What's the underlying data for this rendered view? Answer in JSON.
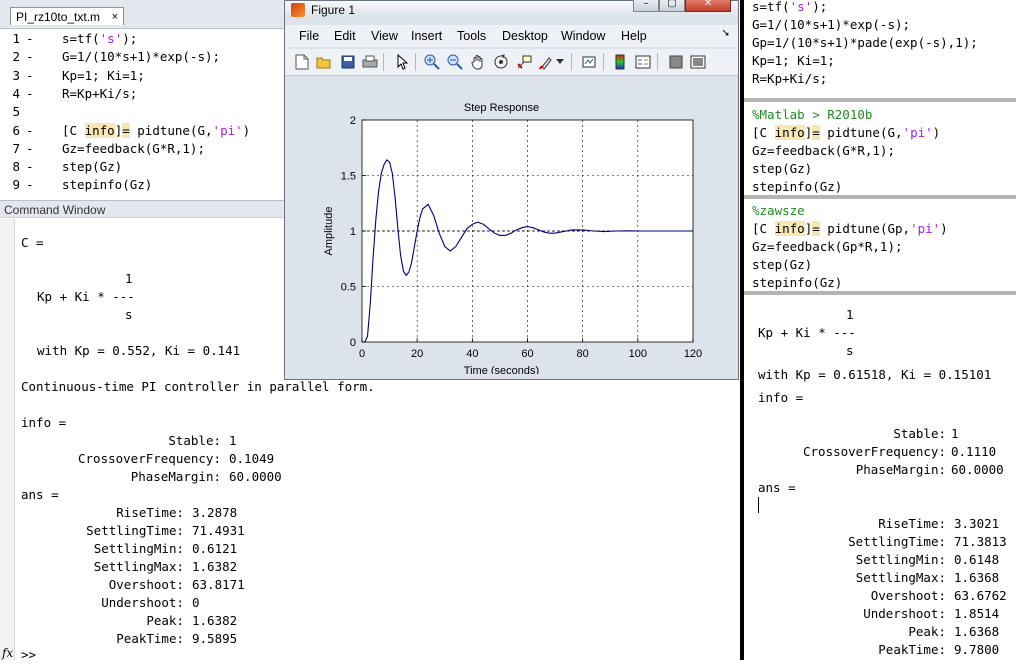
{
  "editor": {
    "tab_label": "PI_rz10to_txt.m",
    "close_label": "×",
    "lines": [
      {
        "num": "1",
        "dash": "-",
        "code": "s=tf('s');"
      },
      {
        "num": "2",
        "dash": "-",
        "code": "G=1/(10*s+1)*exp(-s);"
      },
      {
        "num": "3",
        "dash": "-",
        "code": "Kp=1; Ki=1;"
      },
      {
        "num": "4",
        "dash": "-",
        "code": "R=Kp+Ki/s;"
      },
      {
        "num": "5",
        "dash": "",
        "code": ""
      },
      {
        "num": "6",
        "dash": "-",
        "code": "[C info]= pidtune(G,'pi')"
      },
      {
        "num": "7",
        "dash": "-",
        "code": "Gz=feedback(G*R,1);"
      },
      {
        "num": "8",
        "dash": "-",
        "code": "step(Gz)"
      },
      {
        "num": "9",
        "dash": "-",
        "code": "stepinfo(Gz)"
      }
    ]
  },
  "command_window": {
    "title": "Command Window",
    "fx_label": "fx",
    "prompt": ">>",
    "c_label": "C =",
    "tf_numerator": "1",
    "tf_line": "Kp + Ki * ---",
    "tf_denominator": "s",
    "gains_line": "with Kp = 0.552, Ki = 0.141",
    "controller_desc": "Continuous-time PI controller in parallel form.",
    "info_label": "info =",
    "info": [
      {
        "key": "Stable:",
        "value": "1"
      },
      {
        "key": "CrossoverFrequency:",
        "value": "0.1049"
      },
      {
        "key": "PhaseMargin:",
        "value": "60.0000"
      }
    ],
    "ans_label": "ans =",
    "ans": [
      {
        "key": "RiseTime:",
        "value": "3.2878"
      },
      {
        "key": "SettlingTime:",
        "value": "71.4931"
      },
      {
        "key": "SettlingMin:",
        "value": "0.6121"
      },
      {
        "key": "SettlingMax:",
        "value": "1.6382"
      },
      {
        "key": "Overshoot:",
        "value": "63.8171"
      },
      {
        "key": "Undershoot:",
        "value": "0"
      },
      {
        "key": "Peak:",
        "value": "1.6382"
      },
      {
        "key": "PeakTime:",
        "value": "9.5895"
      }
    ]
  },
  "figure": {
    "window_title": "Figure 1",
    "controls": {
      "minimize": "–",
      "maximize": "▢",
      "close": "✕"
    },
    "menus": [
      "File",
      "Edit",
      "View",
      "Insert",
      "Tools",
      "Desktop",
      "Window",
      "Help"
    ],
    "menu_overflow": "➘",
    "toolbar_icons": [
      "new-figure-icon",
      "open-file-icon",
      "save-icon",
      "print-icon",
      "pointer-icon",
      "zoom-in-icon",
      "zoom-out-icon",
      "pan-icon",
      "rotate-icon",
      "data-cursor-icon",
      "brush-icon",
      "link-plot-icon",
      "colorbar-icon",
      "legend-icon",
      "hide-plot-tools-icon",
      "show-plot-tools-icon"
    ]
  },
  "chart_data": {
    "type": "line",
    "title": "Step Response",
    "xlabel": "Time (seconds)",
    "ylabel": "Amplitude",
    "xlim": [
      0,
      120
    ],
    "ylim": [
      0,
      2
    ],
    "xticks": [
      "0",
      "20",
      "40",
      "60",
      "80",
      "100",
      "120"
    ],
    "yticks": [
      "0",
      "0.5",
      "1",
      "1.5",
      "2"
    ],
    "grid": true,
    "reference_line": 1,
    "series": [
      {
        "color": "#00007f",
        "x": [
          0,
          1,
          2,
          3,
          4,
          5,
          6,
          7,
          8,
          9,
          10,
          11,
          12,
          13,
          14,
          15,
          16,
          17,
          18,
          19,
          20,
          21,
          22,
          24,
          26,
          28,
          30,
          32,
          34,
          36,
          38,
          40,
          42,
          44,
          46,
          48,
          50,
          52,
          54,
          56,
          58,
          60,
          62,
          64,
          66,
          68,
          70,
          72,
          74,
          76,
          78,
          80,
          84,
          88,
          92,
          96,
          100,
          105,
          110,
          115,
          120
        ],
        "y": [
          0,
          0.0,
          0.05,
          0.35,
          0.75,
          1.1,
          1.35,
          1.52,
          1.6,
          1.64,
          1.62,
          1.52,
          1.3,
          1.02,
          0.78,
          0.64,
          0.6,
          0.63,
          0.72,
          0.86,
          1.0,
          1.12,
          1.2,
          1.24,
          1.14,
          0.98,
          0.86,
          0.82,
          0.86,
          0.94,
          1.02,
          1.06,
          1.08,
          1.06,
          1.02,
          0.98,
          0.96,
          0.96,
          0.98,
          1.01,
          1.03,
          1.04,
          1.03,
          1.01,
          0.99,
          0.98,
          0.98,
          0.99,
          1.0,
          1.01,
          1.01,
          1.01,
          1.0,
          0.995,
          1.0,
          1.002,
          1.0,
          1.0,
          1.0,
          1.0,
          1.0
        ]
      }
    ]
  },
  "right_panel": {
    "block1": [
      "s=tf('s');",
      "G=1/(10*s+1)*exp(-s);",
      "Gp=1/(10*s+1)*pade(exp(-s),1);",
      "Kp=1; Ki=1;",
      "R=Kp+Ki/s;"
    ],
    "block2_comment": "%Matlab > R2010b",
    "block2": [
      "[C info]= pidtune(G,'pi')",
      "Gz=feedback(G*R,1);",
      "step(Gz)",
      "stepinfo(Gz)"
    ],
    "block3_comment": "%zawsze",
    "block3": [
      "[C info]= pidtune(Gp,'pi')",
      "Gz=feedback(Gp*R,1);",
      "step(Gz)",
      "stepinfo(Gz)"
    ],
    "output": {
      "tf_numerator": "1",
      "tf_line": "Kp + Ki * ---",
      "tf_denominator": "s",
      "gains_line": "with Kp = 0.61518, Ki = 0.15101",
      "info_label": "info =",
      "info": [
        {
          "key": "Stable:",
          "value": "1"
        },
        {
          "key": "CrossoverFrequency:",
          "value": "0.1110"
        },
        {
          "key": "PhaseMargin:",
          "value": "60.0000"
        }
      ],
      "ans_label": "ans =",
      "ans": [
        {
          "key": "RiseTime:",
          "value": "3.3021"
        },
        {
          "key": "SettlingTime:",
          "value": "71.3813"
        },
        {
          "key": "SettlingMin:",
          "value": "0.6148"
        },
        {
          "key": "SettlingMax:",
          "value": "1.6368"
        },
        {
          "key": "Overshoot:",
          "value": "63.6762"
        },
        {
          "key": "Undershoot:",
          "value": "1.8514"
        },
        {
          "key": "Peak:",
          "value": "1.6368"
        },
        {
          "key": "PeakTime:",
          "value": "9.7800"
        }
      ]
    }
  }
}
